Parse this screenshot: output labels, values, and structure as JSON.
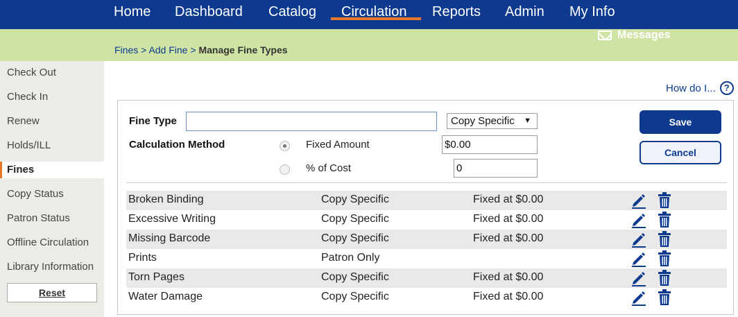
{
  "nav": {
    "items": [
      "Home",
      "Dashboard",
      "Catalog",
      "Circulation",
      "Reports",
      "Admin",
      "My Info"
    ],
    "active": "Circulation"
  },
  "header": {
    "messages_label": "Messages",
    "breadcrumb": {
      "crumb1": "Fines",
      "crumb2": "Add Fine",
      "current": "Manage Fine Types",
      "sep": ">"
    }
  },
  "sidebar": {
    "items": [
      "Check Out",
      "Check In",
      "Renew",
      "Holds/ILL",
      "Fines",
      "Copy Status",
      "Patron Status",
      "Offline Circulation",
      "Library Information"
    ],
    "active": "Fines",
    "reset_label": "Reset"
  },
  "help": {
    "label": "How do I...",
    "icon": "?"
  },
  "form": {
    "fine_type_label": "Fine Type",
    "fine_type_value": "",
    "scope_select": "Copy Specific",
    "calc_method_label": "Calculation Method",
    "option_fixed_label": "Fixed Amount",
    "option_fixed_value": "$0.00",
    "option_percent_label": "% of Cost",
    "option_percent_value": "0",
    "selected_option": "Fixed Amount",
    "save_label": "Save",
    "cancel_label": "Cancel"
  },
  "fine_types": [
    {
      "name": "Broken Binding",
      "scope": "Copy Specific",
      "amount": "Fixed at $0.00"
    },
    {
      "name": "Excessive Writing",
      "scope": "Copy Specific",
      "amount": "Fixed at $0.00"
    },
    {
      "name": "Missing Barcode",
      "scope": "Copy Specific",
      "amount": "Fixed at $0.00"
    },
    {
      "name": "Prints",
      "scope": "Patron Only",
      "amount": ""
    },
    {
      "name": "Torn Pages",
      "scope": "Copy Specific",
      "amount": "Fixed at $0.00"
    },
    {
      "name": "Water Damage",
      "scope": "Copy Specific",
      "amount": "Fixed at $0.00"
    }
  ],
  "colors": {
    "nav_bg": "#0d3a8f",
    "accent": "#e8782a",
    "band": "#cfe3a4",
    "icon": "#0d3a8f"
  },
  "icons": {
    "edit": "pencil-icon",
    "delete": "trash-icon",
    "mail": "mail-icon",
    "help": "help-icon"
  }
}
